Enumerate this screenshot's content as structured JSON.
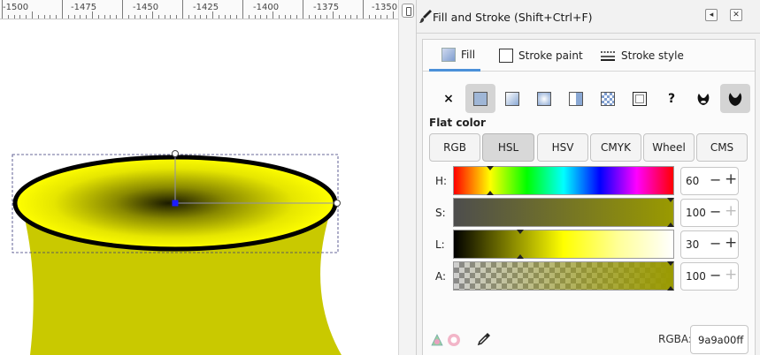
{
  "ruler": {
    "labels": [
      "-1500",
      "-1475",
      "-1450",
      "-1425",
      "-1400",
      "-1375",
      "-1350"
    ]
  },
  "dialog": {
    "title": "Fill and Stroke (Shift+Ctrl+F)",
    "buttons": {
      "collapse": "◂",
      "close": "✕"
    }
  },
  "tabs": [
    {
      "label": "Fill",
      "active": true
    },
    {
      "label": "Stroke paint",
      "active": false
    },
    {
      "label": "Stroke style",
      "active": false
    }
  ],
  "paint_modes": {
    "no_paint": "×",
    "unset": "?",
    "selected": "flat-color"
  },
  "flat_color_label": "Flat color",
  "color_modes": [
    {
      "label": "RGB",
      "selected": false
    },
    {
      "label": "HSL",
      "selected": true
    },
    {
      "label": "HSV",
      "selected": false
    },
    {
      "label": "CMYK",
      "selected": false
    },
    {
      "label": "Wheel",
      "selected": false
    },
    {
      "label": "CMS",
      "selected": false
    }
  ],
  "sliders": {
    "h": {
      "label": "H:",
      "value": "60"
    },
    "s": {
      "label": "S:",
      "value": "100"
    },
    "l": {
      "label": "L:",
      "value": "30"
    },
    "a": {
      "label": "A:",
      "value": "100"
    }
  },
  "rgba": {
    "label": "RGBA:",
    "value": "9a9a00ff"
  },
  "colors": {
    "fill": "#9a9a00",
    "accent": "#4a90d9",
    "selection_handle": "#1c1cff"
  }
}
